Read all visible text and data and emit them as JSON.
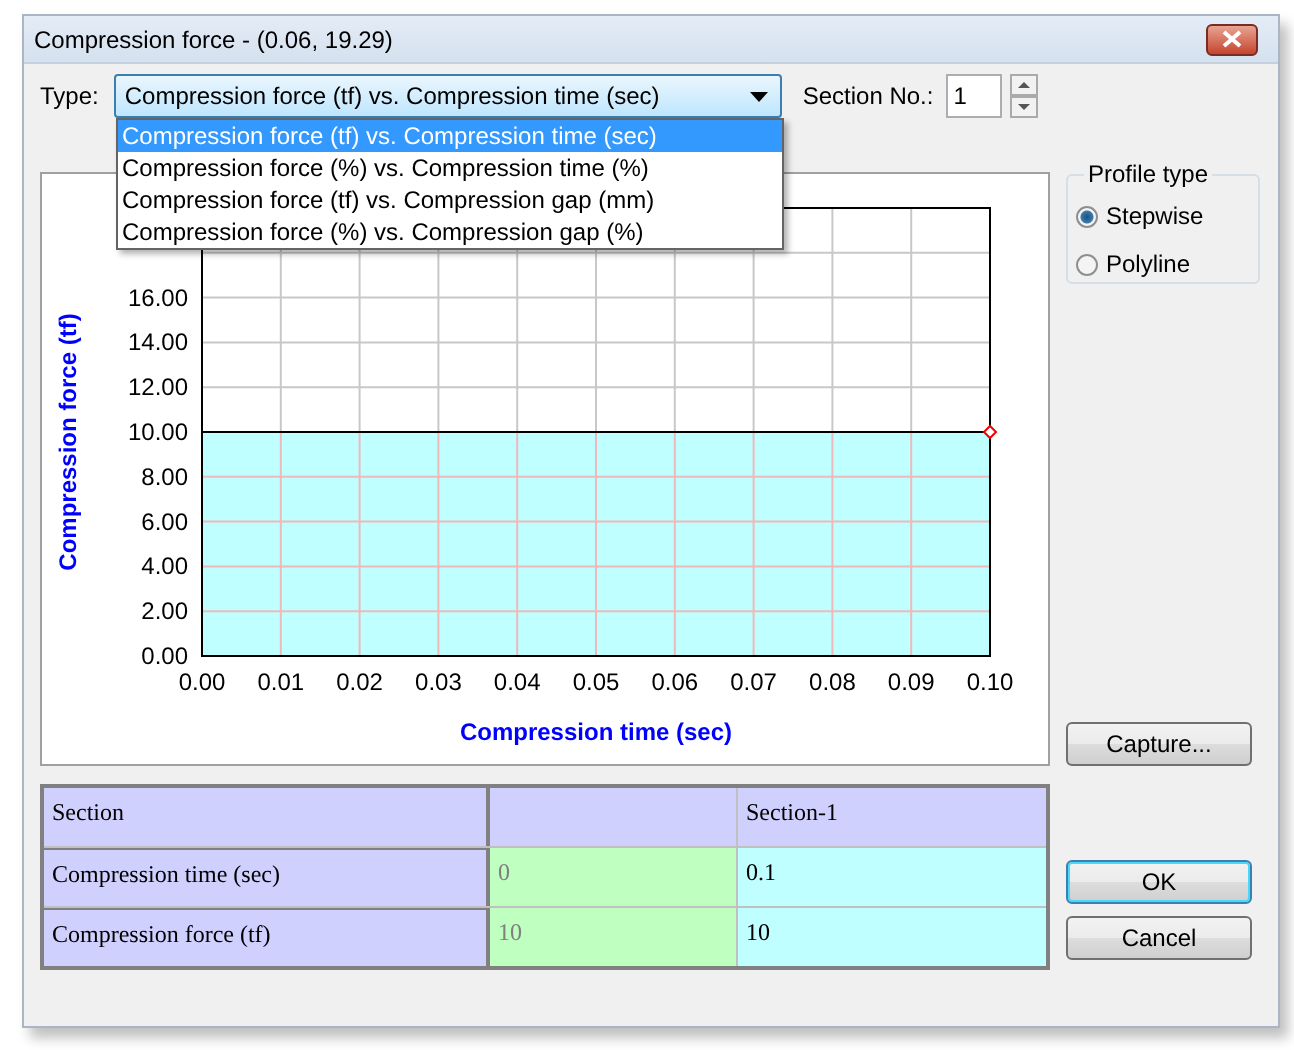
{
  "window": {
    "title": "Compression force - (0.06, 19.29)"
  },
  "type_field": {
    "label": "Type:",
    "value": "Compression force (tf) vs. Compression time (sec)",
    "expanded": true,
    "options": [
      {
        "label": "Compression force (tf) vs. Compression time (sec)",
        "selected": true
      },
      {
        "label": "Compression force (%) vs. Compression time (%)",
        "selected": false
      },
      {
        "label": "Compression force (tf) vs. Compression gap (mm)",
        "selected": false
      },
      {
        "label": "Compression force (%) vs. Compression gap (%)",
        "selected": false
      }
    ]
  },
  "section_no": {
    "label": "Section No.:",
    "value": "1"
  },
  "profile_type": {
    "title": "Profile type",
    "options": [
      {
        "label": "Stepwise",
        "selected": true
      },
      {
        "label": "Polyline",
        "selected": false
      }
    ]
  },
  "chart": {
    "chart_data": {
      "type": "area",
      "xlabel": "Compression time (sec)",
      "ylabel": "Compression force (tf)",
      "x": [
        0,
        0.1
      ],
      "series": [
        {
          "color": "#000000",
          "values": [
            10,
            10
          ]
        }
      ],
      "xlim": [
        0,
        0.1
      ],
      "ylim": [
        0,
        20
      ],
      "grid": true,
      "xticks": [
        {
          "value": 0,
          "label": "0.00"
        },
        {
          "value": 0.01,
          "label": "0.01"
        },
        {
          "value": 0.02,
          "label": "0.02"
        },
        {
          "value": 0.03,
          "label": "0.03"
        },
        {
          "value": 0.04,
          "label": "0.04"
        },
        {
          "value": 0.05,
          "label": "0.05"
        },
        {
          "value": 0.06,
          "label": "0.06"
        },
        {
          "value": 0.07,
          "label": "0.07"
        },
        {
          "value": 0.08,
          "label": "0.08"
        },
        {
          "value": 0.09,
          "label": "0.09"
        },
        {
          "value": 0.1,
          "label": "0.10"
        }
      ],
      "yticks": [
        {
          "value": 0,
          "label": "0.00"
        },
        {
          "value": 2,
          "label": "2.00"
        },
        {
          "value": 4,
          "label": "4.00"
        },
        {
          "value": 6,
          "label": "6.00"
        },
        {
          "value": 8,
          "label": "8.00"
        },
        {
          "value": 10,
          "label": "10.00"
        },
        {
          "value": 12,
          "label": "12.00"
        },
        {
          "value": 14,
          "label": "14.00"
        },
        {
          "value": 16,
          "label": "16.00"
        }
      ]
    }
  },
  "table": {
    "header": {
      "label": "Section",
      "value": "Section-1"
    },
    "rows": [
      {
        "label": "Compression time (sec)",
        "start": "0",
        "value": "0.1"
      },
      {
        "label": "Compression force (tf)",
        "start": "10",
        "value": "10"
      }
    ]
  },
  "buttons": {
    "capture": "Capture...",
    "ok": "OK",
    "cancel": "Cancel"
  }
}
